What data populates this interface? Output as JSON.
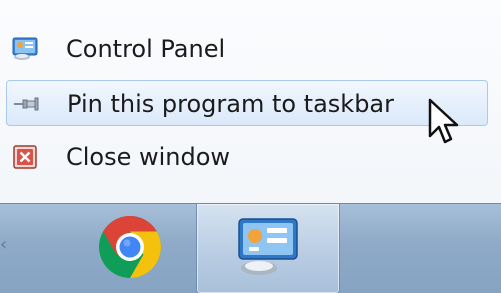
{
  "jump_list": {
    "items": [
      {
        "label": "Control Panel",
        "icon": "control-panel-icon"
      },
      {
        "label": "Pin this program to taskbar",
        "icon": "pin-icon",
        "state": "hovered"
      },
      {
        "label": "Close window",
        "icon": "close-window-icon"
      }
    ]
  },
  "taskbar": {
    "buttons": [
      {
        "app_icon": "chrome-icon",
        "active": false
      },
      {
        "app_icon": "control-panel-icon",
        "active": true
      }
    ]
  },
  "colors": {
    "hover_border": "#a9c9ee",
    "hover_fill": "#dbe9fa",
    "taskbar": "#8eaac8",
    "close_icon_red": "#c83a2a",
    "chrome_red": "#db4437",
    "chrome_yellow": "#f4c20d",
    "chrome_green": "#0f9d58",
    "chrome_blue": "#4285f4"
  }
}
